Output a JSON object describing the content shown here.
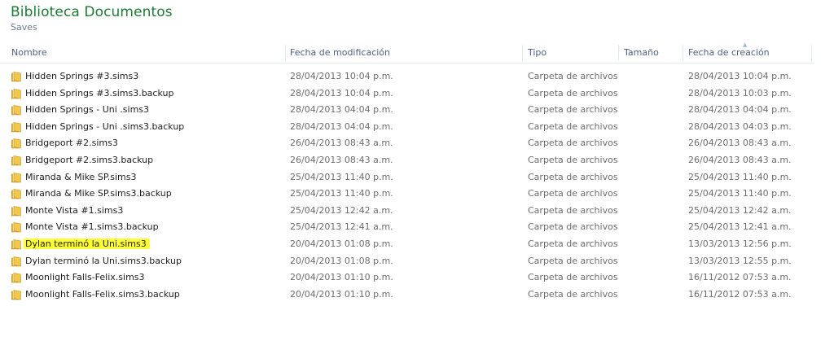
{
  "library": {
    "title": "Biblioteca Documentos",
    "subtitle": "Saves"
  },
  "columns": {
    "name": "Nombre",
    "modified": "Fecha de modificación",
    "type": "Tipo",
    "size": "Tamaño",
    "created": "Fecha de creación"
  },
  "colors": {
    "title_green": "#1e7b34",
    "header_text": "#4d6185",
    "highlight_yellow": "#ffff33",
    "folder_yellow": "#e8c04a"
  },
  "icons": {
    "folder": "folder-icon"
  },
  "files": [
    {
      "name": "Hidden Springs #3.sims3",
      "modified": "28/04/2013 10:04 p.m.",
      "type": "Carpeta de archivos",
      "size": "",
      "created": "28/04/2013 10:04 p.m."
    },
    {
      "name": "Hidden Springs #3.sims3.backup",
      "modified": "28/04/2013 10:04 p.m.",
      "type": "Carpeta de archivos",
      "size": "",
      "created": "28/04/2013 10:03 p.m."
    },
    {
      "name": "Hidden Springs - Uni .sims3",
      "modified": "28/04/2013 04:04 p.m.",
      "type": "Carpeta de archivos",
      "size": "",
      "created": "28/04/2013 04:04 p.m."
    },
    {
      "name": "Hidden Springs - Uni .sims3.backup",
      "modified": "28/04/2013 04:04 p.m.",
      "type": "Carpeta de archivos",
      "size": "",
      "created": "28/04/2013 04:03 p.m."
    },
    {
      "name": "Bridgeport #2.sims3",
      "modified": "26/04/2013 08:43 a.m.",
      "type": "Carpeta de archivos",
      "size": "",
      "created": "26/04/2013 08:43 a.m."
    },
    {
      "name": "Bridgeport #2.sims3.backup",
      "modified": "26/04/2013 08:43 a.m.",
      "type": "Carpeta de archivos",
      "size": "",
      "created": "26/04/2013 08:43 a.m."
    },
    {
      "name": "Miranda & Mike SP.sims3",
      "modified": "25/04/2013 11:40 p.m.",
      "type": "Carpeta de archivos",
      "size": "",
      "created": "25/04/2013 11:40 p.m."
    },
    {
      "name": "Miranda & Mike SP.sims3.backup",
      "modified": "25/04/2013 11:40 p.m.",
      "type": "Carpeta de archivos",
      "size": "",
      "created": "25/04/2013 11:40 p.m."
    },
    {
      "name": "Monte Vista #1.sims3",
      "modified": "25/04/2013 12:42 a.m.",
      "type": "Carpeta de archivos",
      "size": "",
      "created": "25/04/2013 12:42 a.m."
    },
    {
      "name": "Monte Vista #1.sims3.backup",
      "modified": "25/04/2013 12:41 a.m.",
      "type": "Carpeta de archivos",
      "size": "",
      "created": "25/04/2013 12:41 a.m."
    },
    {
      "name": "Dylan terminó la Uni.sims3",
      "modified": "20/04/2013 01:08 p.m.",
      "type": "Carpeta de archivos",
      "size": "",
      "created": "13/03/2013 12:56 p.m.",
      "highlighted": true
    },
    {
      "name": "Dylan terminó la Uni.sims3.backup",
      "modified": "20/04/2013 01:08 p.m.",
      "type": "Carpeta de archivos",
      "size": "",
      "created": "13/03/2013 12:55 p.m."
    },
    {
      "name": "Moonlight Falls-Felix.sims3",
      "modified": "20/04/2013 01:10 p.m.",
      "type": "Carpeta de archivos",
      "size": "",
      "created": "16/11/2012 07:53 a.m."
    },
    {
      "name": "Moonlight Falls-Felix.sims3.backup",
      "modified": "20/04/2013 01:10 p.m.",
      "type": "Carpeta de archivos",
      "size": "",
      "created": "16/11/2012 07:53 a.m."
    }
  ]
}
